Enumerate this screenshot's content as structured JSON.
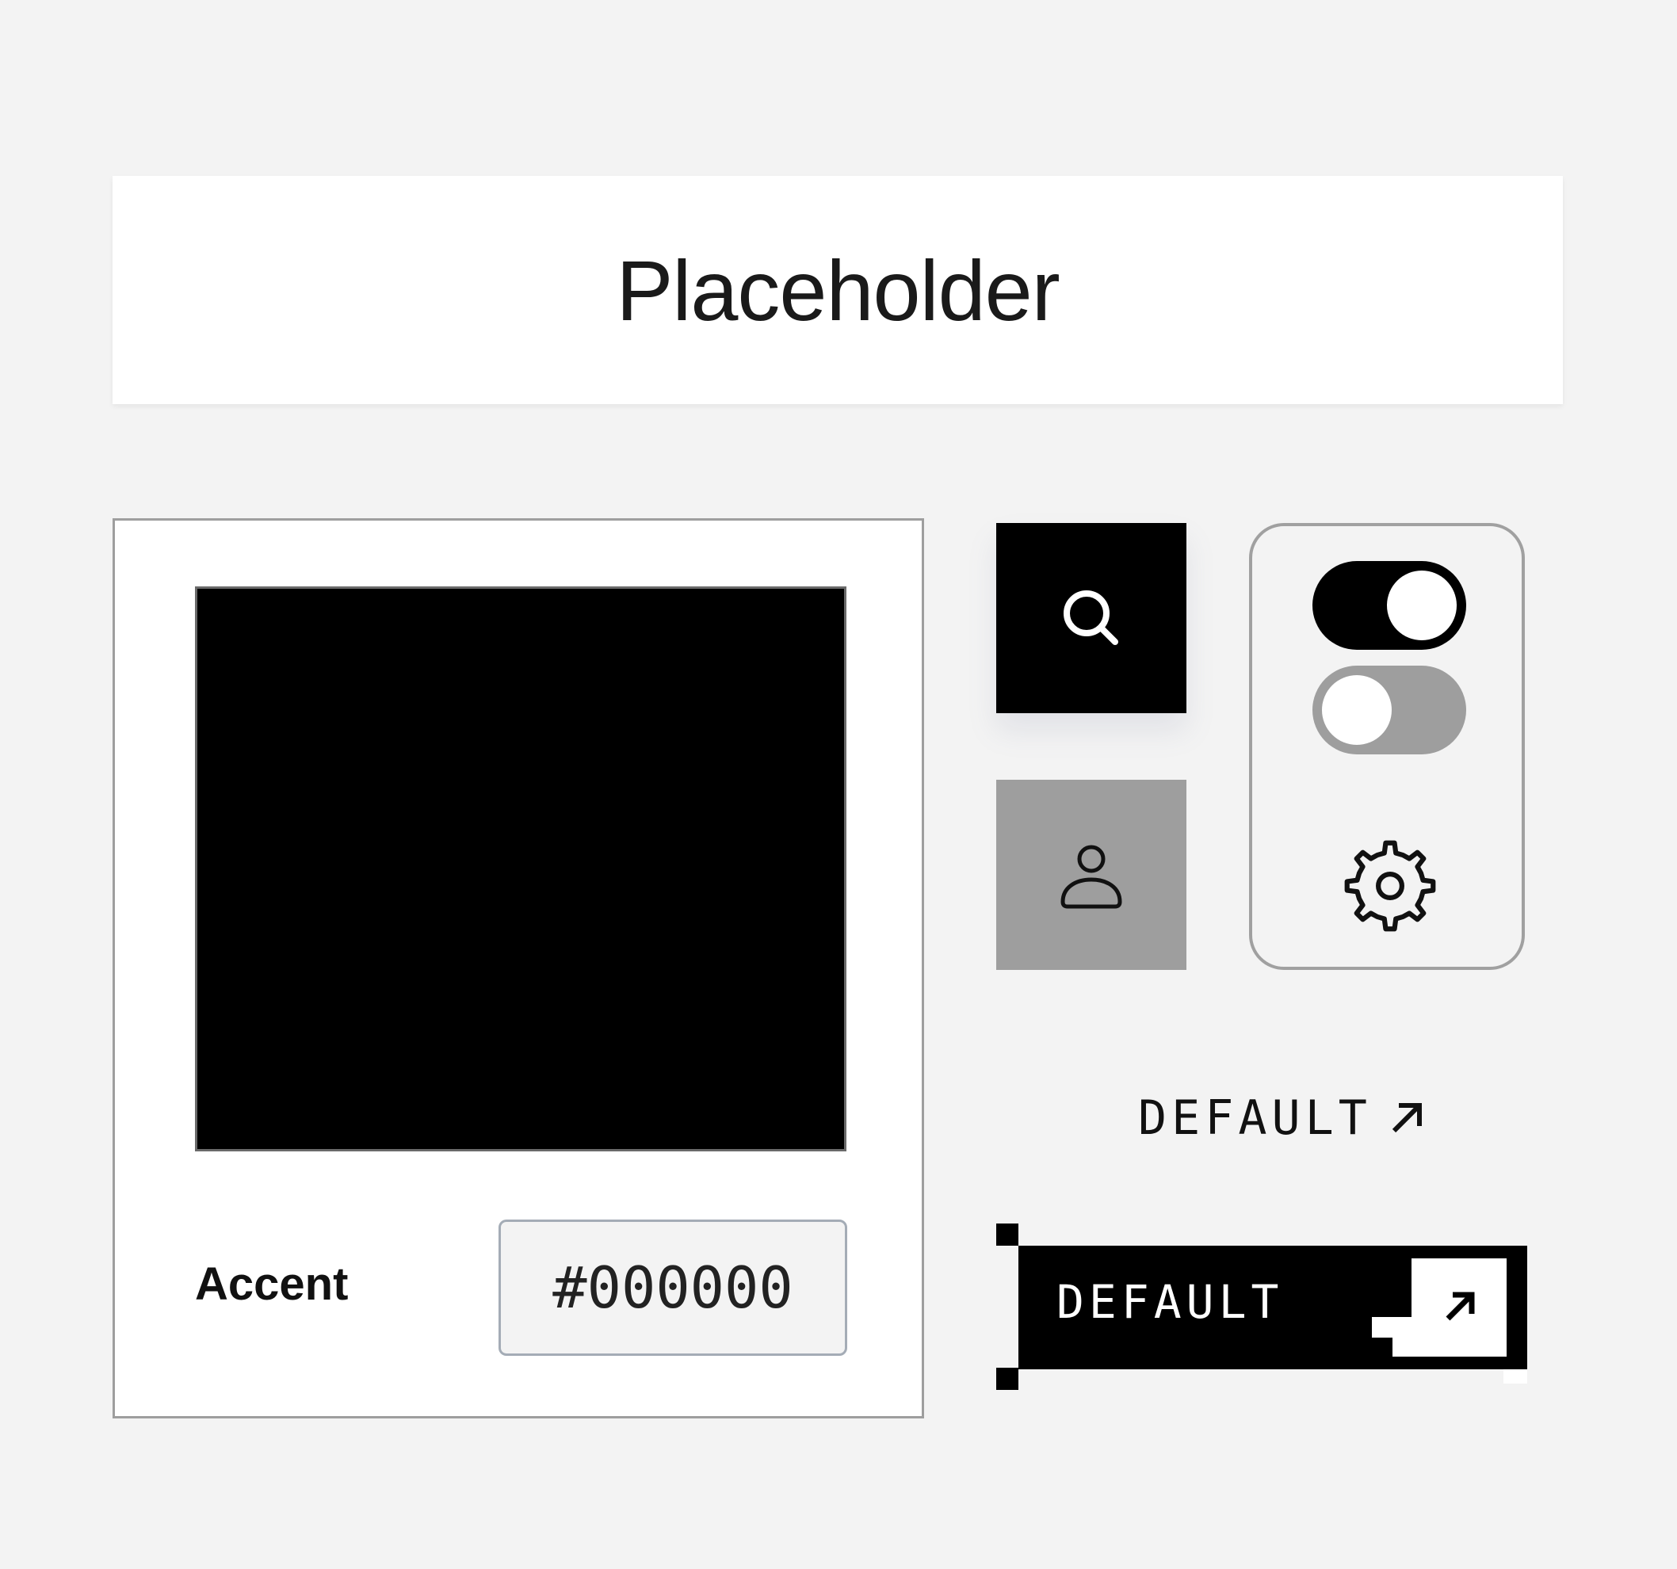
{
  "header": {
    "title": "Placeholder"
  },
  "color_picker": {
    "swatch_color": "#000000",
    "label": "Accent",
    "hex_value": "#000000"
  },
  "icon_buttons": {
    "search_icon": "search-icon",
    "user_icon": "user-icon"
  },
  "toggles": [
    {
      "state": "on"
    },
    {
      "state": "off"
    }
  ],
  "settings": {
    "icon": "gear-icon"
  },
  "links": {
    "default_link_label": "DEFAULT",
    "default_link_icon": "arrow-up-right-icon"
  },
  "pixel_button": {
    "label": "DEFAULT",
    "icon": "arrow-up-right-icon"
  },
  "colors": {
    "background": "#f3f3f3",
    "primary": "#000000",
    "muted": "#9e9e9e",
    "surface": "#ffffff"
  }
}
